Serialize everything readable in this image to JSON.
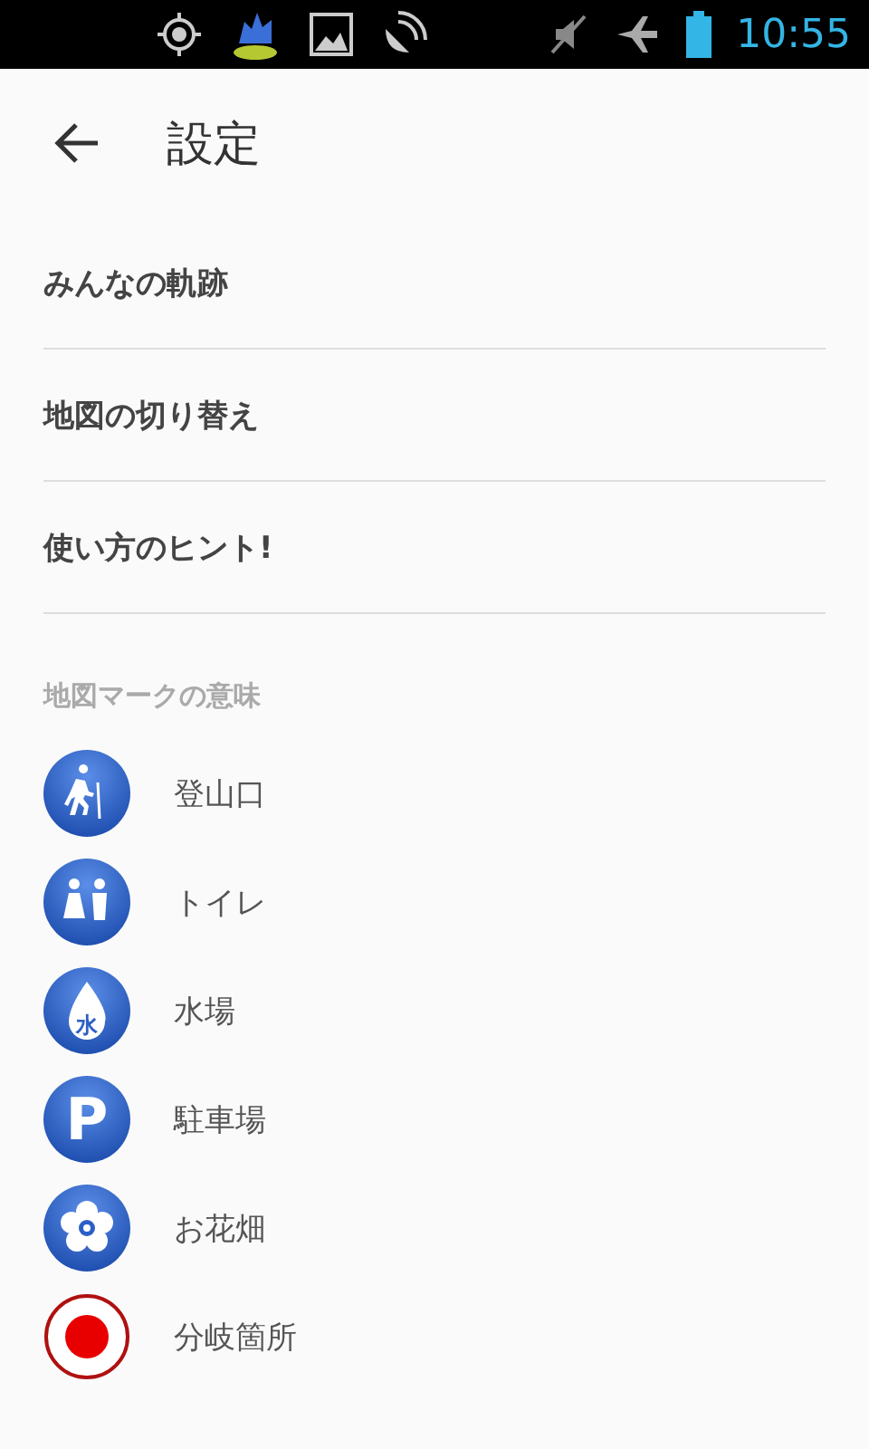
{
  "status_bar": {
    "time": "10:55"
  },
  "header": {
    "title": "設定"
  },
  "menu_items": [
    {
      "label": "みんなの軌跡"
    },
    {
      "label": "地図の切り替え"
    },
    {
      "label": "使い方のヒント!"
    }
  ],
  "legend": {
    "heading": "地図マークの意味",
    "items": [
      {
        "kind": "hiker",
        "label": "登山口"
      },
      {
        "kind": "toilet",
        "label": "トイレ"
      },
      {
        "kind": "water",
        "glyph": "水",
        "label": "水場"
      },
      {
        "kind": "parking",
        "glyph": "P",
        "label": "駐車場"
      },
      {
        "kind": "flower",
        "label": "お花畑"
      },
      {
        "kind": "junction",
        "label": "分岐箇所"
      }
    ]
  }
}
